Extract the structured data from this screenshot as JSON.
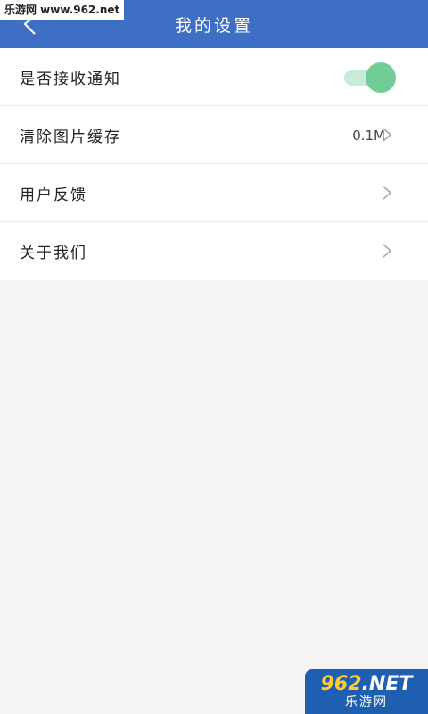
{
  "header": {
    "title": "我的设置",
    "back_icon": "chevron-left-icon",
    "background": "#3e6fc4"
  },
  "watermark": {
    "top_text": "乐游网 www.962.net",
    "bottom_brand_num": "962",
    "bottom_brand_suffix": ".NET",
    "bottom_sub": "乐游网"
  },
  "settings": {
    "notifications": {
      "label": "是否接收通知",
      "enabled": true
    },
    "clear_cache": {
      "label": "清除图片缓存",
      "value": "0.1M"
    },
    "feedback": {
      "label": "用户反馈"
    },
    "about": {
      "label": "关于我们"
    }
  },
  "colors": {
    "toggle_on": "#72cc95",
    "toggle_track": "#c8eadb",
    "background": "#f5f5f5"
  }
}
